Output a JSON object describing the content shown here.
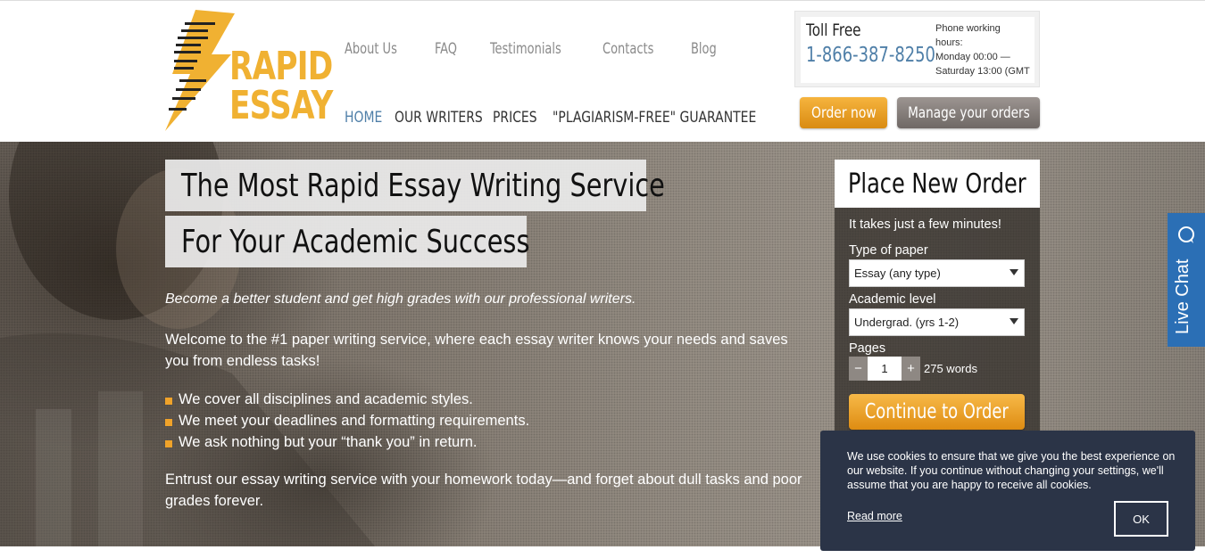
{
  "logo": {
    "line1": "RAPID",
    "line2": "ESSAY",
    "brand_color": "#f0b132"
  },
  "topnav": {
    "items": [
      {
        "label": "About Us"
      },
      {
        "label": "FAQ"
      },
      {
        "label": "Testimonials"
      },
      {
        "label": "Contacts"
      },
      {
        "label": "Blog"
      }
    ]
  },
  "mainnav": {
    "items": [
      {
        "label": "HOME",
        "active": true
      },
      {
        "label": "OUR WRITERS",
        "active": false
      },
      {
        "label": "PRICES",
        "active": false
      },
      {
        "label": "\"PLAGIARISM-FREE\" GUARANTEE",
        "active": false
      }
    ]
  },
  "contact": {
    "toll_label": "Toll Free",
    "phone": "1-866-387-8250",
    "hours_line1": "Phone working",
    "hours_line2": "hours:",
    "hours_line3": "Monday 00:00 —",
    "hours_line4": "Saturday 13:00 (GMT"
  },
  "header_buttons": {
    "order_now": "Order now",
    "manage_orders": "Manage your orders"
  },
  "hero": {
    "headline1": "The Most Rapid Essay Writing Service",
    "headline2": "For Your Academic Success",
    "tagline": "Become a better student and get high grades with our professional writers.",
    "welcome": "Welcome to the #1 paper writing service, where each essay writer knows your needs and saves you from endless tasks!",
    "bullets": [
      "We cover all disciplines and academic styles.",
      "We meet your deadlines and formatting requirements.",
      "We ask nothing but your “thank you” in return."
    ],
    "entrust": "Entrust our essay writing service with your homework today—and forget about dull tasks and poor grades forever."
  },
  "order_form": {
    "title": "Place New Order",
    "subtitle": "It takes just a few minutes!",
    "type_label": "Type of paper",
    "type_value": "Essay (any type)",
    "level_label": "Academic level",
    "level_value": "Undergrad. (yrs 1-2)",
    "pages_label": "Pages",
    "pages_minus": "−",
    "pages_value": "1",
    "pages_plus": "+",
    "words": "275 words",
    "continue": "Continue to Order"
  },
  "livechat": {
    "label": "Live Chat",
    "color": "#2b6fb5"
  },
  "cookie": {
    "text": "We use cookies to ensure that we give you the best experience on our website. If you continue without changing your settings, we'll assume that you are happy to receive all cookies.",
    "read_more": "Read more",
    "ok": "OK"
  },
  "colors": {
    "accent_orange": "#f0a32a",
    "link_blue": "#4f7fa8",
    "cookie_bg": "#2b3447"
  }
}
